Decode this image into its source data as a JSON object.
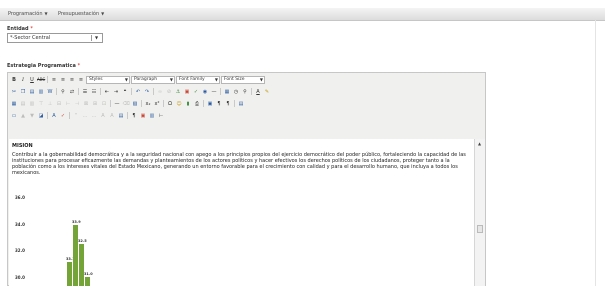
{
  "menu": {
    "items": [
      {
        "label": "Programación"
      },
      {
        "label": "Presupuestación"
      }
    ]
  },
  "entidad": {
    "label": "Entidad",
    "required_mark": "*",
    "selected_value": "*-Sector Central"
  },
  "estrategia": {
    "label": "Estrategia Programatica",
    "required_mark": "*"
  },
  "toolbar": {
    "styles_value": "Styles",
    "paragraph_value": "Paragraph",
    "font_family_value": "Font Family",
    "font_size_value": "Font Size"
  },
  "content": {
    "heading": "MISION",
    "paragraph": "Contribuir a la gobernabilidad democrática y a la seguridad nacional con apego a los principios propios del ejercicio democrático del poder público, fortaleciendo la capacidad de las instituciones para procesar eficazmente las demandas y planteamientos de los actores políticos y hacer efectivos los derechos políticos de los ciudadanos, proteger tanto a la población como a los intereses vitales del Estado Mexicano, generando un entorno favorable para el crecimiento con calidad y para el desarrollo humano, que incluya a todos los mexicanos."
  },
  "chart_data": {
    "type": "bar",
    "y_ticks": [
      "36.0",
      "34.0",
      "32.0",
      "30.0"
    ],
    "ylim": [
      29.4,
      36.0
    ],
    "values": [
      31.1,
      33.9,
      32.5,
      30.0
    ],
    "data_labels": [
      "33.1",
      "33.9",
      "32.5",
      "31.0"
    ],
    "bar_color": "#74a338"
  },
  "colors": {
    "required": "#dd1111",
    "bar": "#74a338"
  }
}
